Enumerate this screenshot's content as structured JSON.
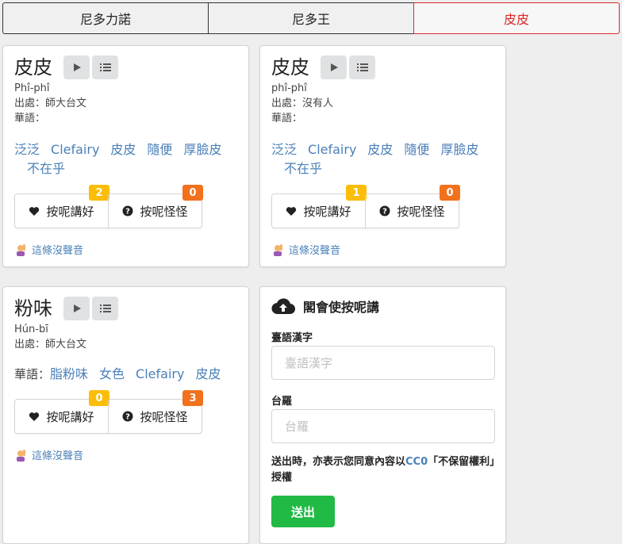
{
  "tabs": [
    {
      "label": "尼多力諾"
    },
    {
      "label": "尼多王"
    },
    {
      "label": "皮皮"
    }
  ],
  "cards": [
    {
      "word": "皮皮",
      "roman": "Phî-phî",
      "source": "出處：師大台文",
      "mandarin_label": "華語：",
      "links": [
        "泛泛",
        "Clefairy",
        "皮皮",
        "隨便",
        "厚臉皮",
        "不在乎"
      ],
      "like_label": "按呢講好",
      "like_count": "2",
      "weird_label": "按呢怪怪",
      "weird_count": "0",
      "no_sound": "這條沒聲音"
    },
    {
      "word": "皮皮",
      "roman": "phî-phî",
      "source": "出處：沒有人",
      "mandarin_label": "華語：",
      "links": [
        "泛泛",
        "Clefairy",
        "皮皮",
        "隨便",
        "厚臉皮",
        "不在乎"
      ],
      "like_label": "按呢講好",
      "like_count": "1",
      "weird_label": "按呢怪怪",
      "weird_count": "0",
      "no_sound": "這條沒聲音"
    },
    {
      "word": "粉味",
      "roman": "Hún-bī",
      "source": "出處：師大台文",
      "mandarin_label": "華語：",
      "links": [
        "脂粉味",
        "女色",
        "Clefairy",
        "皮皮"
      ],
      "like_label": "按呢講好",
      "like_count": "0",
      "weird_label": "按呢怪怪",
      "weird_count": "3",
      "no_sound": "這條沒聲音"
    }
  ],
  "form": {
    "title": "閣會使按呢講",
    "hanzi_label": "臺語漢字",
    "hanzi_placeholder": "臺語漢字",
    "tailo_label": "台羅",
    "tailo_placeholder": "台羅",
    "note_prefix": "送出時，亦表示您同意內容以",
    "note_link": "CC0",
    "note_suffix": "「不保留權利」授權",
    "submit_label": "送出"
  },
  "colors": {
    "active_tab": "#db2828",
    "link": "#4a80b8",
    "badge_yellow": "#fbbd08",
    "badge_orange": "#f2711c",
    "submit": "#21ba45"
  }
}
